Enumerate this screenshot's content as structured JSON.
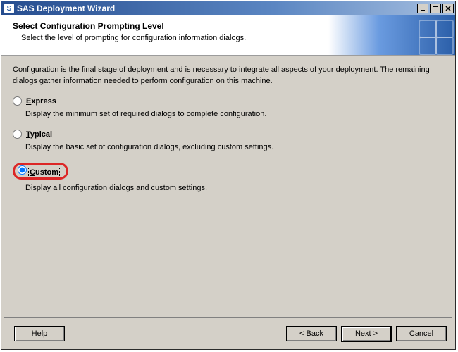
{
  "titlebar": {
    "icon_letter": "S",
    "title": "SAS Deployment Wizard"
  },
  "banner": {
    "heading": "Select Configuration Prompting Level",
    "subheading": "Select the level of prompting for configuration information dialogs."
  },
  "intro": "Configuration is the final stage of deployment and is necessary to integrate all aspects of your deployment.  The remaining dialogs gather information needed to perform configuration on this machine.",
  "options": [
    {
      "id": "express",
      "accel": "E",
      "label_rest": "xpress",
      "desc": "Display the minimum set of required dialogs to complete configuration.",
      "selected": false,
      "highlighted": false
    },
    {
      "id": "typical",
      "accel": "T",
      "label_rest": "ypical",
      "desc": "Display the basic set of configuration dialogs, excluding custom settings.",
      "selected": false,
      "highlighted": false
    },
    {
      "id": "custom",
      "accel": "C",
      "label_rest": "ustom",
      "desc": "Display all configuration dialogs and custom settings.",
      "selected": true,
      "highlighted": true
    }
  ],
  "buttons": {
    "help_accel": "H",
    "help_rest": "elp",
    "back_pre": "< ",
    "back_accel": "B",
    "back_rest": "ack",
    "next_accel": "N",
    "next_rest": "ext >",
    "cancel": "Cancel"
  }
}
